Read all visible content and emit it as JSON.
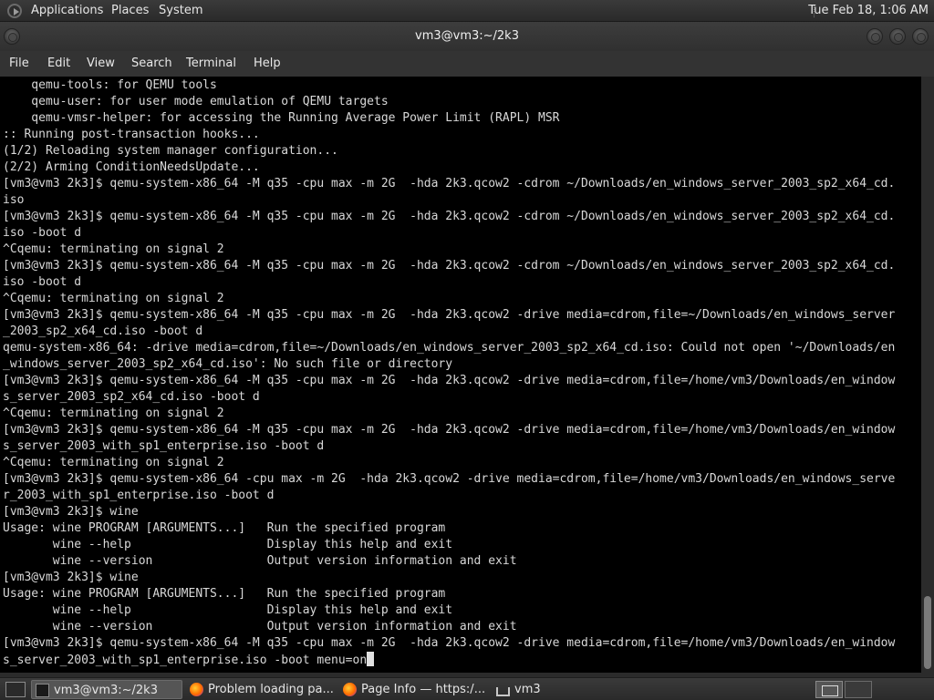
{
  "top_panel": {
    "applications": "Applications",
    "places": "Places",
    "system": "System",
    "clock": "Tue Feb 18, 1:06 AM"
  },
  "window": {
    "title": "vm3@vm3:~/2k3"
  },
  "menubar": {
    "items": [
      "File",
      "Edit",
      "View",
      "Search",
      "Terminal",
      "Help"
    ]
  },
  "terminal": {
    "lines": [
      "    qemu-tools: for QEMU tools",
      "    qemu-user: for user mode emulation of QEMU targets",
      "    qemu-vmsr-helper: for accessing the Running Average Power Limit (RAPL) MSR",
      ":: Running post-transaction hooks...",
      "(1/2) Reloading system manager configuration...",
      "(2/2) Arming ConditionNeedsUpdate...",
      "[vm3@vm3 2k3]$ qemu-system-x86_64 -M q35 -cpu max -m 2G  -hda 2k3.qcow2 -cdrom ~/Downloads/en_windows_server_2003_sp2_x64_cd.",
      "iso",
      "[vm3@vm3 2k3]$ qemu-system-x86_64 -M q35 -cpu max -m 2G  -hda 2k3.qcow2 -cdrom ~/Downloads/en_windows_server_2003_sp2_x64_cd.",
      "iso -boot d",
      "^Cqemu: terminating on signal 2",
      "[vm3@vm3 2k3]$ qemu-system-x86_64 -M q35 -cpu max -m 2G  -hda 2k3.qcow2 -cdrom ~/Downloads/en_windows_server_2003_sp2_x64_cd.",
      "iso -boot d",
      "^Cqemu: terminating on signal 2",
      "[vm3@vm3 2k3]$ qemu-system-x86_64 -M q35 -cpu max -m 2G  -hda 2k3.qcow2 -drive media=cdrom,file=~/Downloads/en_windows_server",
      "_2003_sp2_x64_cd.iso -boot d",
      "qemu-system-x86_64: -drive media=cdrom,file=~/Downloads/en_windows_server_2003_sp2_x64_cd.iso: Could not open '~/Downloads/en",
      "_windows_server_2003_sp2_x64_cd.iso': No such file or directory",
      "[vm3@vm3 2k3]$ qemu-system-x86_64 -M q35 -cpu max -m 2G  -hda 2k3.qcow2 -drive media=cdrom,file=/home/vm3/Downloads/en_window",
      "s_server_2003_sp2_x64_cd.iso -boot d",
      "^Cqemu: terminating on signal 2",
      "[vm3@vm3 2k3]$ qemu-system-x86_64 -M q35 -cpu max -m 2G  -hda 2k3.qcow2 -drive media=cdrom,file=/home/vm3/Downloads/en_window",
      "s_server_2003_with_sp1_enterprise.iso -boot d",
      "^Cqemu: terminating on signal 2",
      "[vm3@vm3 2k3]$ qemu-system-x86_64 -cpu max -m 2G  -hda 2k3.qcow2 -drive media=cdrom,file=/home/vm3/Downloads/en_windows_serve",
      "r_2003_with_sp1_enterprise.iso -boot d",
      "[vm3@vm3 2k3]$ wine",
      "Usage: wine PROGRAM [ARGUMENTS...]   Run the specified program",
      "       wine --help                   Display this help and exit",
      "       wine --version                Output version information and exit",
      "[vm3@vm3 2k3]$ wine",
      "Usage: wine PROGRAM [ARGUMENTS...]   Run the specified program",
      "       wine --help                   Display this help and exit",
      "       wine --version                Output version information and exit",
      "[vm3@vm3 2k3]$ qemu-system-x86_64 -M q35 -cpu max -m 2G  -hda 2k3.qcow2 -drive media=cdrom,file=/home/vm3/Downloads/en_window",
      "s_server_2003_with_sp1_enterprise.iso -boot menu=on"
    ]
  },
  "taskbar": {
    "tasks": [
      {
        "label": "vm3@vm3:~/2k3",
        "icon": "terminal-icon"
      },
      {
        "label": "Problem loading pa...",
        "icon": "firefox-icon"
      },
      {
        "label": "Page Info — https:/...",
        "icon": "firefox-icon"
      },
      {
        "label": "vm3",
        "icon": "home-folder-icon"
      }
    ]
  }
}
